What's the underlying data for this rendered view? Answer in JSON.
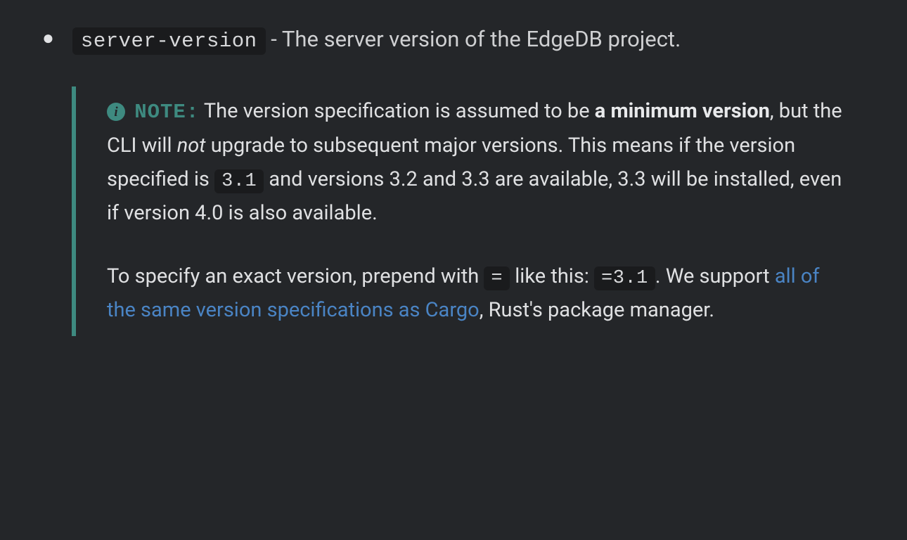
{
  "bullet": {
    "code": "server-version",
    "desc": " - The server version of the EdgeDB project."
  },
  "note": {
    "label": "NOTE:",
    "p1": {
      "t1": "  The version specification is assumed to be ",
      "bold1": "a minimum version",
      "t2": ", but the CLI will ",
      "em1": "not",
      "t3": " upgrade to subsequent major versions. This means if the version specified is ",
      "code1": "3.1",
      "t4": " and versions 3.2 and 3.3 are available, 3.3 will be installed, even if version 4.0 is also available."
    },
    "p2": {
      "t1": "To specify an exact version, prepend with ",
      "code1": "=",
      "t2": " like this: ",
      "code2": "=3.1",
      "t3": ". We support ",
      "link": "all of the same version specifications as Cargo",
      "t4": ", Rust's package manager."
    }
  }
}
